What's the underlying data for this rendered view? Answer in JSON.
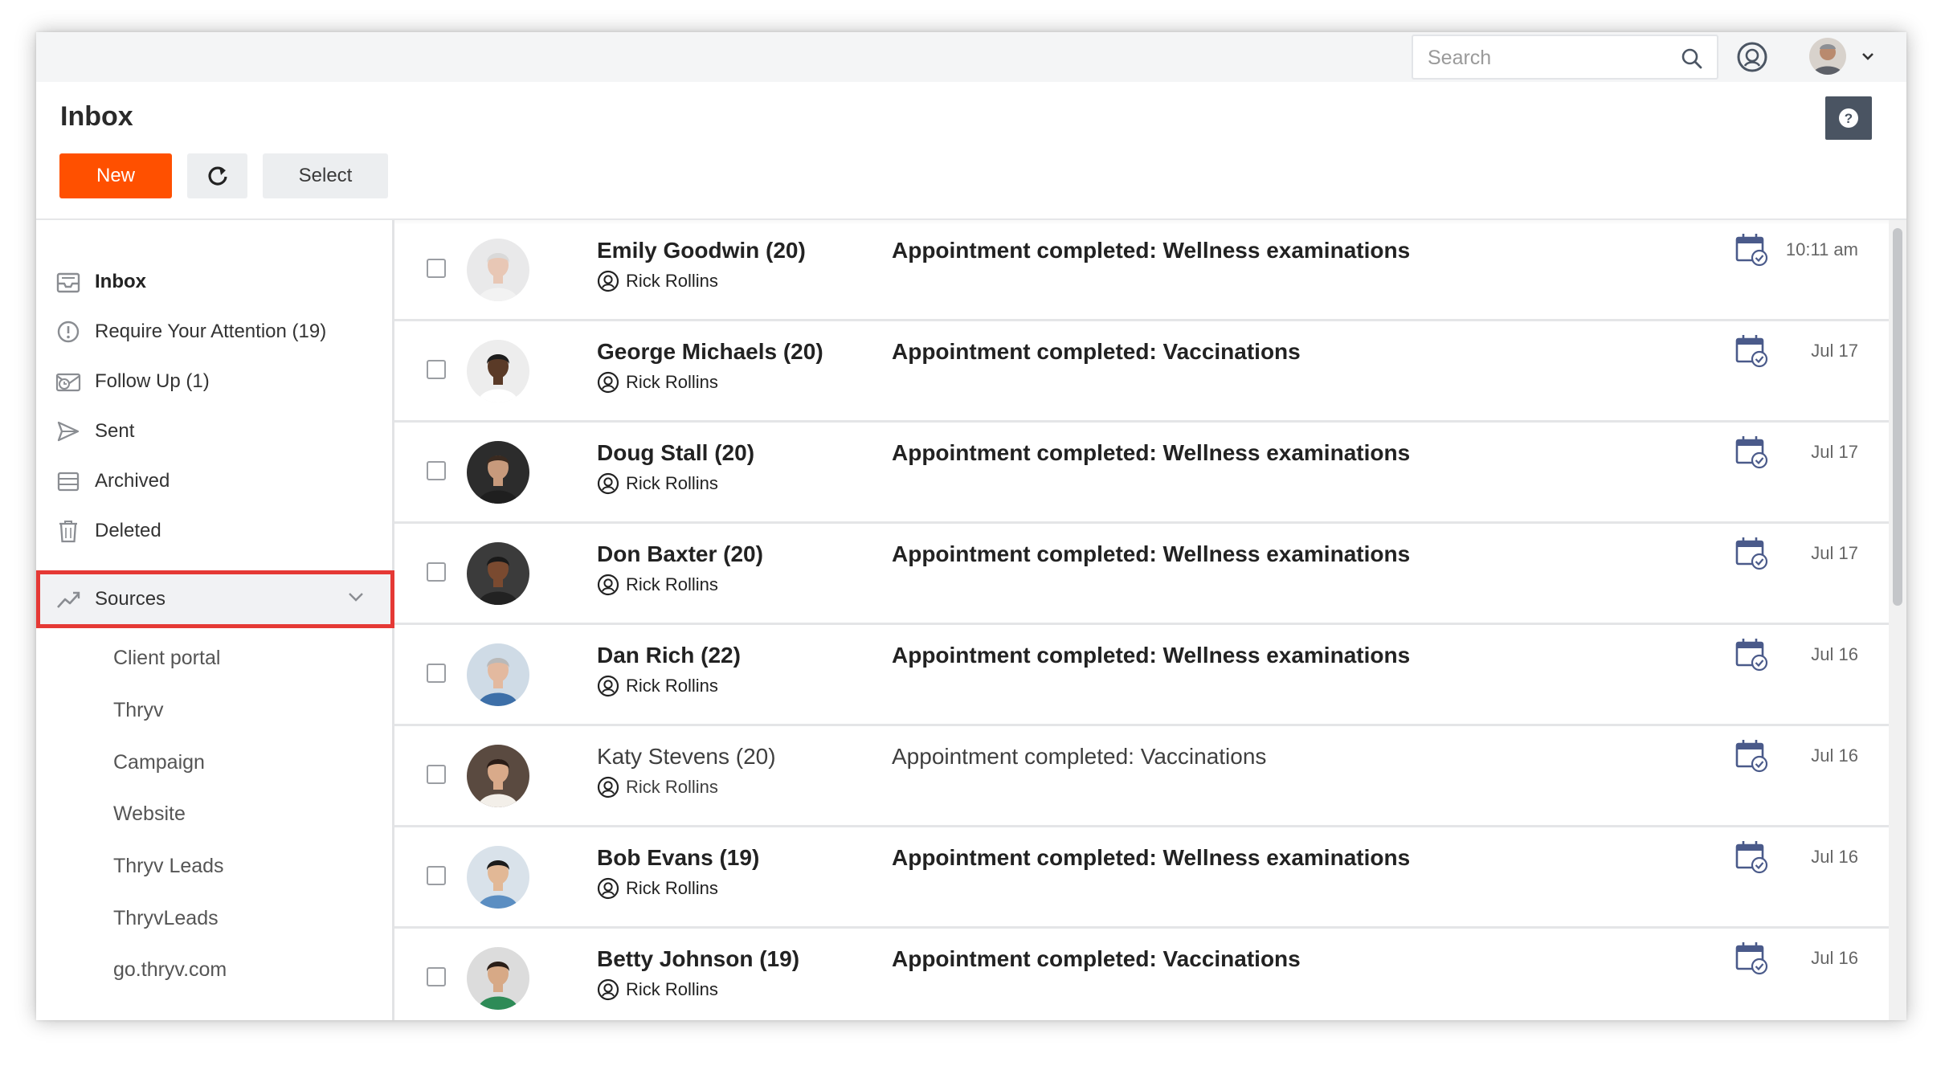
{
  "topbar": {
    "search_placeholder": "Search",
    "icons": [
      "search-icon",
      "support-icon",
      "user-avatar",
      "chevron-down-icon"
    ]
  },
  "header": {
    "title": "Inbox",
    "new_label": "New",
    "select_label": "Select",
    "help_label": "?"
  },
  "colors": {
    "accent": "#ff5000",
    "highlight_border": "#e53935",
    "help_bg": "#4a5462",
    "calendar_icon": "#4a5a8a"
  },
  "sidebar": {
    "items": [
      {
        "label": "Inbox",
        "icon": "inbox-icon"
      },
      {
        "label": "Require Your Attention (19)",
        "icon": "alert-circle-icon"
      },
      {
        "label": "Follow Up (1)",
        "icon": "follow-up-icon"
      },
      {
        "label": "Sent",
        "icon": "send-icon"
      },
      {
        "label": "Archived",
        "icon": "archive-icon"
      },
      {
        "label": "Deleted",
        "icon": "trash-icon"
      },
      {
        "label": "Sources",
        "icon": "trend-icon"
      }
    ],
    "sources": [
      "Client portal",
      "Thryv",
      "Campaign",
      "Website",
      "Thryv Leads",
      "ThryvLeads",
      "go.thryv.com"
    ]
  },
  "messages": [
    {
      "name": "Emily Goodwin (20)",
      "assignee": "Rick Rollins",
      "subject": "Appointment completed: Wellness examinations",
      "time": "10:11 am"
    },
    {
      "name": "George Michaels (20)",
      "assignee": "Rick Rollins",
      "subject": "Appointment completed: Vaccinations",
      "time": "Jul 17"
    },
    {
      "name": "Doug Stall (20)",
      "assignee": "Rick Rollins",
      "subject": "Appointment completed: Wellness examinations",
      "time": "Jul 17"
    },
    {
      "name": "Don Baxter (20)",
      "assignee": "Rick Rollins",
      "subject": "Appointment completed: Wellness examinations",
      "time": "Jul 17"
    },
    {
      "name": "Dan Rich (22)",
      "assignee": "Rick Rollins",
      "subject": "Appointment completed: Wellness examinations",
      "time": "Jul 16"
    },
    {
      "name": "Katy Stevens (20)",
      "assignee": "Rick Rollins",
      "subject": "Appointment completed: Vaccinations",
      "time": "Jul 16"
    },
    {
      "name": "Bob Evans (19)",
      "assignee": "Rick Rollins",
      "subject": "Appointment completed: Wellness examinations",
      "time": "Jul 16"
    },
    {
      "name": "Betty Johnson (19)",
      "assignee": "Rick Rollins",
      "subject": "Appointment completed: Vaccinations",
      "time": "Jul 16"
    }
  ]
}
